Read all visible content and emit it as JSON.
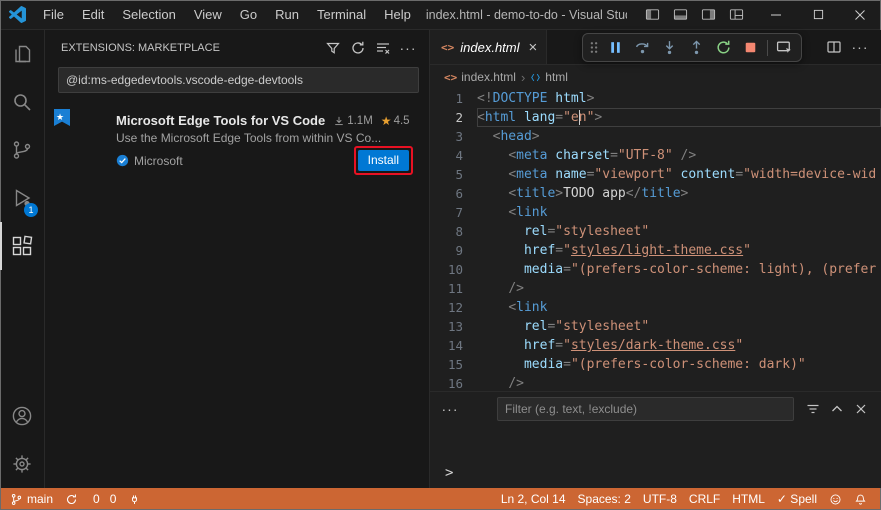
{
  "colors": {
    "accent": "#0078d4",
    "statusbar": "#cc6633",
    "annotation": "#e81123",
    "star": "#e8a030"
  },
  "icons": {
    "more": "···",
    "star": "★",
    "chevron": "›",
    "html_file": "<>",
    "close": "×"
  },
  "titlebar": {
    "menus": [
      "File",
      "Edit",
      "Selection",
      "View",
      "Go",
      "Run",
      "Terminal",
      "Help"
    ],
    "title": "index.html - demo-to-do - Visual Studio C"
  },
  "activitybar": {
    "debug_badge": "1"
  },
  "sidebar": {
    "header": "EXTENSIONS: MARKETPLACE",
    "search_value": "@id:ms-edgedevtools.vscode-edge-devtools",
    "extension": {
      "name": "Microsoft Edge Tools for VS Code",
      "installs": "1.1M",
      "rating": "4.5",
      "description": "Use the Microsoft Edge Tools from within VS Co...",
      "publisher": "Microsoft",
      "install_label": "Install"
    }
  },
  "editor": {
    "tab_label": "index.html",
    "breadcrumbs": {
      "file": "index.html",
      "symbol": "html"
    },
    "active_line": 2,
    "cursor_col": 14,
    "lines": [
      {
        "n": 1,
        "t": [
          [
            "p",
            "<!"
          ],
          [
            "tg",
            "DOCTYPE"
          ],
          [
            "at",
            " html"
          ],
          [
            "p",
            ">"
          ]
        ]
      },
      {
        "n": 2,
        "t": [
          [
            "p",
            "<"
          ],
          [
            "tg",
            "html"
          ],
          [
            "x",
            " "
          ],
          [
            "at",
            "lang"
          ],
          [
            "p",
            "="
          ],
          [
            "s",
            "\"en\""
          ],
          [
            "p",
            ">"
          ]
        ]
      },
      {
        "n": 3,
        "t": [
          [
            "x",
            "  "
          ],
          [
            "p",
            "<"
          ],
          [
            "tg",
            "head"
          ],
          [
            "p",
            ">"
          ]
        ]
      },
      {
        "n": 4,
        "t": [
          [
            "x",
            "    "
          ],
          [
            "p",
            "<"
          ],
          [
            "tg",
            "meta"
          ],
          [
            "x",
            " "
          ],
          [
            "at",
            "charset"
          ],
          [
            "p",
            "="
          ],
          [
            "s",
            "\"UTF-8\""
          ],
          [
            "x",
            " "
          ],
          [
            "p",
            "/>"
          ]
        ]
      },
      {
        "n": 5,
        "t": [
          [
            "x",
            "    "
          ],
          [
            "p",
            "<"
          ],
          [
            "tg",
            "meta"
          ],
          [
            "x",
            " "
          ],
          [
            "at",
            "name"
          ],
          [
            "p",
            "="
          ],
          [
            "s",
            "\"viewport\""
          ],
          [
            "x",
            " "
          ],
          [
            "at",
            "content"
          ],
          [
            "p",
            "="
          ],
          [
            "s",
            "\"width=device-wid"
          ]
        ]
      },
      {
        "n": 6,
        "t": [
          [
            "x",
            "    "
          ],
          [
            "p",
            "<"
          ],
          [
            "tg",
            "title"
          ],
          [
            "p",
            ">"
          ],
          [
            "x",
            "TODO app"
          ],
          [
            "p",
            "</"
          ],
          [
            "tg",
            "title"
          ],
          [
            "p",
            ">"
          ]
        ]
      },
      {
        "n": 7,
        "t": [
          [
            "x",
            "    "
          ],
          [
            "p",
            "<"
          ],
          [
            "tg",
            "link"
          ]
        ]
      },
      {
        "n": 8,
        "t": [
          [
            "x",
            "      "
          ],
          [
            "at",
            "rel"
          ],
          [
            "p",
            "="
          ],
          [
            "s",
            "\"stylesheet\""
          ]
        ]
      },
      {
        "n": 9,
        "t": [
          [
            "x",
            "      "
          ],
          [
            "at",
            "href"
          ],
          [
            "p",
            "="
          ],
          [
            "s",
            "\""
          ],
          [
            "lk",
            "styles/light-theme.css"
          ],
          [
            "s",
            "\""
          ]
        ]
      },
      {
        "n": 10,
        "t": [
          [
            "x",
            "      "
          ],
          [
            "at",
            "media"
          ],
          [
            "p",
            "="
          ],
          [
            "s",
            "\"(prefers-color-scheme: light), (prefer"
          ]
        ]
      },
      {
        "n": 11,
        "t": [
          [
            "x",
            "    "
          ],
          [
            "p",
            "/>"
          ]
        ]
      },
      {
        "n": 12,
        "t": [
          [
            "x",
            "    "
          ],
          [
            "p",
            "<"
          ],
          [
            "tg",
            "link"
          ]
        ]
      },
      {
        "n": 13,
        "t": [
          [
            "x",
            "      "
          ],
          [
            "at",
            "rel"
          ],
          [
            "p",
            "="
          ],
          [
            "s",
            "\"stylesheet\""
          ]
        ]
      },
      {
        "n": 14,
        "t": [
          [
            "x",
            "      "
          ],
          [
            "at",
            "href"
          ],
          [
            "p",
            "="
          ],
          [
            "s",
            "\""
          ],
          [
            "lk",
            "styles/dark-theme.css"
          ],
          [
            "s",
            "\""
          ]
        ]
      },
      {
        "n": 15,
        "t": [
          [
            "x",
            "      "
          ],
          [
            "at",
            "media"
          ],
          [
            "p",
            "="
          ],
          [
            "s",
            "\"(prefers-color-scheme: dark)\""
          ]
        ]
      },
      {
        "n": 16,
        "t": [
          [
            "x",
            "    "
          ],
          [
            "p",
            "/>"
          ]
        ]
      }
    ]
  },
  "panel": {
    "filter_placeholder": "Filter (e.g. text, !exclude)",
    "prompt": ">"
  },
  "statusbar": {
    "branch": "main",
    "errors": "0",
    "warnings": "0",
    "right": [
      {
        "name": "cursor-position",
        "label": "Ln 2, Col 14"
      },
      {
        "name": "indentation",
        "label": "Spaces: 2"
      },
      {
        "name": "encoding",
        "label": "UTF-8"
      },
      {
        "name": "eol",
        "label": "CRLF"
      },
      {
        "name": "language-mode",
        "label": "HTML"
      },
      {
        "name": "spell-checker",
        "label": "✓ Spell"
      }
    ]
  }
}
